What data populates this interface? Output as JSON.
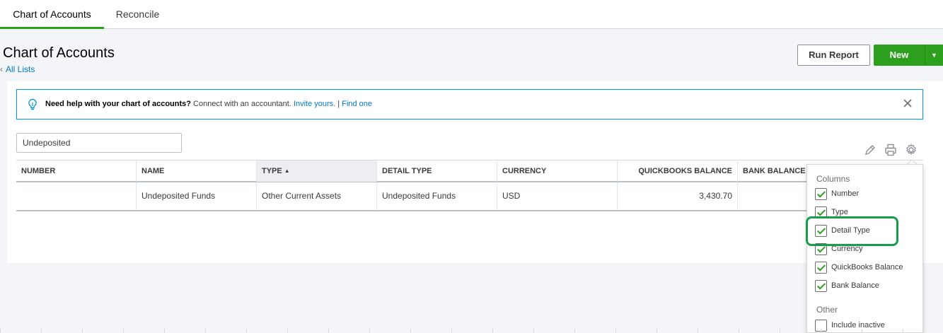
{
  "tabs": [
    {
      "label": "Chart of Accounts",
      "active": true
    },
    {
      "label": "Reconcile",
      "active": false
    }
  ],
  "page": {
    "title": "Chart of Accounts",
    "back_link": "All Lists"
  },
  "actions": {
    "run_report": "Run Report",
    "new": "New"
  },
  "banner": {
    "bold": "Need help with your chart of accounts?",
    "text": " Connect with an accountant. ",
    "link1": "Invite yours.",
    "sep": " | ",
    "link2": "Find one",
    "icon": "lightbulb-icon"
  },
  "search": {
    "value": "Undeposited"
  },
  "table": {
    "columns": [
      "NUMBER",
      "NAME",
      "TYPE",
      "DETAIL TYPE",
      "CURRENCY",
      "QUICKBOOKS BALANCE",
      "BANK BALANCE"
    ],
    "sorted_column": "TYPE",
    "rows": [
      {
        "number": "",
        "name": "Undeposited Funds",
        "type": "Other Current Assets",
        "detail_type": "Undeposited Funds",
        "currency": "USD",
        "qb_balance": "3,430.70",
        "bank_balance": ""
      }
    ]
  },
  "settings_popover": {
    "columns_heading": "Columns",
    "columns": [
      {
        "label": "Number",
        "checked": true
      },
      {
        "label": "Type",
        "checked": true
      },
      {
        "label": "Detail Type",
        "checked": true
      },
      {
        "label": "Currency",
        "checked": true
      },
      {
        "label": "QuickBooks Balance",
        "checked": true
      },
      {
        "label": "Bank Balance",
        "checked": true
      }
    ],
    "other_heading": "Other",
    "other": [
      {
        "label": "Include inactive",
        "checked": false
      }
    ]
  },
  "colors": {
    "accent_green": "#2ca01c",
    "link_blue": "#0077c5",
    "banner_border": "#0097e6",
    "highlight": "#1a9c4d"
  }
}
